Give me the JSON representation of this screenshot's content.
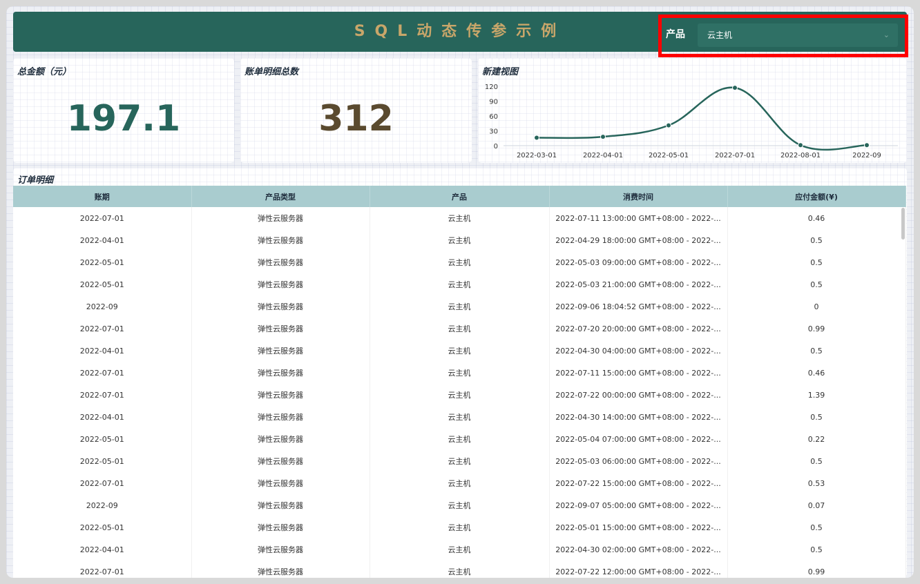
{
  "header": {
    "title": "SQL动态传参示例",
    "filter_label": "产品",
    "filter_value": "云主机"
  },
  "kpis": [
    {
      "title": "总金额（元）",
      "value": "197.1",
      "color": "#27655b"
    },
    {
      "title": "账单明细总数",
      "value": "312",
      "color": "#5a4a2f"
    }
  ],
  "chart_card": {
    "title": "新建视图"
  },
  "chart_data": {
    "type": "line",
    "x": [
      "2022-03-01",
      "2022-04-01",
      "2022-05-01",
      "2022-07-01",
      "2022-08-01",
      "2022-09"
    ],
    "values": [
      16,
      18,
      41,
      117,
      1,
      1
    ],
    "ylim": [
      0,
      120
    ],
    "yticks": [
      0,
      30,
      60,
      90,
      120
    ],
    "color": "#27655b",
    "grid": false
  },
  "table": {
    "title": "订单明细",
    "columns": [
      "账期",
      "产品类型",
      "产品",
      "消费时间",
      "应付金额(¥)"
    ],
    "rows": [
      [
        "2022-07-01",
        "弹性云服务器",
        "云主机",
        "2022-07-11 13:00:00 GMT+08:00 - 2022-...",
        "0.46"
      ],
      [
        "2022-04-01",
        "弹性云服务器",
        "云主机",
        "2022-04-29 18:00:00 GMT+08:00 - 2022-...",
        "0.5"
      ],
      [
        "2022-05-01",
        "弹性云服务器",
        "云主机",
        "2022-05-03 09:00:00 GMT+08:00 - 2022-...",
        "0.5"
      ],
      [
        "2022-05-01",
        "弹性云服务器",
        "云主机",
        "2022-05-03 21:00:00 GMT+08:00 - 2022-...",
        "0.5"
      ],
      [
        "2022-09",
        "弹性云服务器",
        "云主机",
        "2022-09-06 18:04:52 GMT+08:00 - 2022-...",
        "0"
      ],
      [
        "2022-07-01",
        "弹性云服务器",
        "云主机",
        "2022-07-20 20:00:00 GMT+08:00 - 2022-...",
        "0.99"
      ],
      [
        "2022-04-01",
        "弹性云服务器",
        "云主机",
        "2022-04-30 04:00:00 GMT+08:00 - 2022-...",
        "0.5"
      ],
      [
        "2022-07-01",
        "弹性云服务器",
        "云主机",
        "2022-07-11 15:00:00 GMT+08:00 - 2022-...",
        "0.46"
      ],
      [
        "2022-07-01",
        "弹性云服务器",
        "云主机",
        "2022-07-22 00:00:00 GMT+08:00 - 2022-...",
        "1.39"
      ],
      [
        "2022-04-01",
        "弹性云服务器",
        "云主机",
        "2022-04-30 14:00:00 GMT+08:00 - 2022-...",
        "0.5"
      ],
      [
        "2022-05-01",
        "弹性云服务器",
        "云主机",
        "2022-05-04 07:00:00 GMT+08:00 - 2022-...",
        "0.22"
      ],
      [
        "2022-05-01",
        "弹性云服务器",
        "云主机",
        "2022-05-03 06:00:00 GMT+08:00 - 2022-...",
        "0.5"
      ],
      [
        "2022-07-01",
        "弹性云服务器",
        "云主机",
        "2022-07-22 15:00:00 GMT+08:00 - 2022-...",
        "0.53"
      ],
      [
        "2022-09",
        "弹性云服务器",
        "云主机",
        "2022-09-07 05:00:00 GMT+08:00 - 2022-...",
        "0.07"
      ],
      [
        "2022-05-01",
        "弹性云服务器",
        "云主机",
        "2022-05-01 15:00:00 GMT+08:00 - 2022-...",
        "0.5"
      ],
      [
        "2022-04-01",
        "弹性云服务器",
        "云主机",
        "2022-04-30 02:00:00 GMT+08:00 - 2022-...",
        "0.5"
      ],
      [
        "2022-07-01",
        "弹性云服务器",
        "云主机",
        "2022-07-22 12:00:00 GMT+08:00 - 2022-...",
        "0.99"
      ]
    ]
  }
}
